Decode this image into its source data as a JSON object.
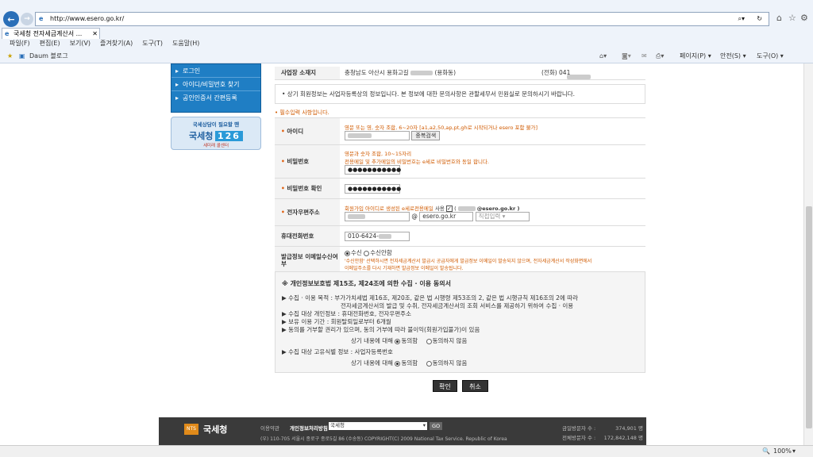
{
  "browser": {
    "url": "http://www.esero.go.kr/",
    "tab_title": "국세청 전자세금계산서 ...",
    "menu": [
      "파일(F)",
      "편집(E)",
      "보기(V)",
      "즐겨찾기(A)",
      "도구(T)",
      "도움말(H)"
    ],
    "favorite": "Daum 블로그",
    "cmd": {
      "page": "페이지(P) ▾",
      "safety": "안전(S) ▾",
      "tools": "도구(O) ▾"
    },
    "zoom": "100%"
  },
  "sidebar": {
    "items": [
      "로그인",
      "아이디/비밀번호 찾기",
      "공인인증서 간편등록"
    ],
    "banner_line1": "국세상담이 필요할 땐",
    "banner_brand": "국세청",
    "banner_number": "126",
    "banner_sub": "세미래 콜센터"
  },
  "form": {
    "address_label": "사업장 소재지",
    "address_value": "충청남도 아산시 용화고길",
    "address_suffix": "(용화동)",
    "phone_label": "(전화) 041",
    "notice": "• 상기 회원정보는 사업자등록상의 정보입니다. 본 정보에 대한 문의사항은 관할세무서 민원실로 문의하시기 바랍니다.",
    "required_note": "• 필수입력 사항입니다.",
    "id_label": "아이디",
    "id_hint": "영문 또는 영, 숫자 조합, 6~20자 [a1,a2,50,ap,pt,gh로 시작되거나 esero 포함 불가]",
    "dup_button": "중복검색",
    "pw_label": "비밀번호",
    "pw_hint1": "영문과 숫자 조합, 10~15자리",
    "pw_hint2": "전용메일 및 추가메일의 비밀번호는 e세로 비밀번호와 동일 합니다.",
    "pw_value": "●●●●●●●●●●●",
    "pw_confirm_label": "비밀번호 확인",
    "pw_confirm_value": "●●●●●●●●●●●",
    "email_label": "전자우편주소",
    "email_hint": "회원가입 아이디로 생성된 e세로전용메일",
    "email_use": "사용",
    "email_addr": "@esero.go.kr )",
    "email_at": "@",
    "email_domain": "esero.go.kr",
    "email_select": "직접입력",
    "mobile_label": "휴대전화번호",
    "mobile_value": "010-6424-",
    "receive_label": "발급정보 이메일수신여부",
    "receive_opt1": "수신",
    "receive_opt2": "수신안함",
    "receive_note1": "'수신안함' 선택하시면 전자세금계산서 발급시 공급자에게 발급정보 이메일이 발송되지 않으며, 전자세금계산서 작성화면에서",
    "receive_note2": "이메일주소를 다시 기재하면 발급정보 이메일이 발송됩니다."
  },
  "agreement": {
    "title": "※ 개인정보보호법 제15조, 제24조에 의한 수집 · 이용 동의서",
    "purpose1": "▶ 수집 · 이용 목적 : 부가가치세법 제16조, 제20조, 같은 법 시행령 제53조의 2, 같은 법 시행규칙 제16조의 2에 따라",
    "purpose2": "전자세금계산서의 발급 및 수취, 전자세금계산서의 조회 서비스를 제공하기 위하여 수집 · 이용",
    "items": "▶ 수집 대상 개인정보 : 휴대전화번호, 전자우편주소",
    "period": "▶ 보유 이용 기간 : 회원탈퇴일로부터 6개월",
    "refuse": "▶ 동의를 거부할 권리가 있으며, 동의 거부에 따라 불이익(회원가입불가)이 있음",
    "consent_q": "상기 내용에 대해",
    "agree": "동의함",
    "disagree": "동의하지 않음",
    "unique": "▶ 수집 대상 고유식별 정보 : 사업자등록번호"
  },
  "buttons": {
    "ok": "확인",
    "cancel": "취소"
  },
  "footer": {
    "logo": "국세청",
    "links": "이용약관",
    "privacy": "개인정보처리방침",
    "select": "국세청",
    "go": "GO",
    "address": "(우) 110-705 서울시 종로구 종로5길 86 (수송동)   COPYRIGHT(C) 2009 National Tax Service. Republic of Korea",
    "today_label": "금일방문자 수 :",
    "today_value": "374,901 명",
    "total_label": "전체방문자 수 :",
    "total_value": "172,842,148 명"
  }
}
